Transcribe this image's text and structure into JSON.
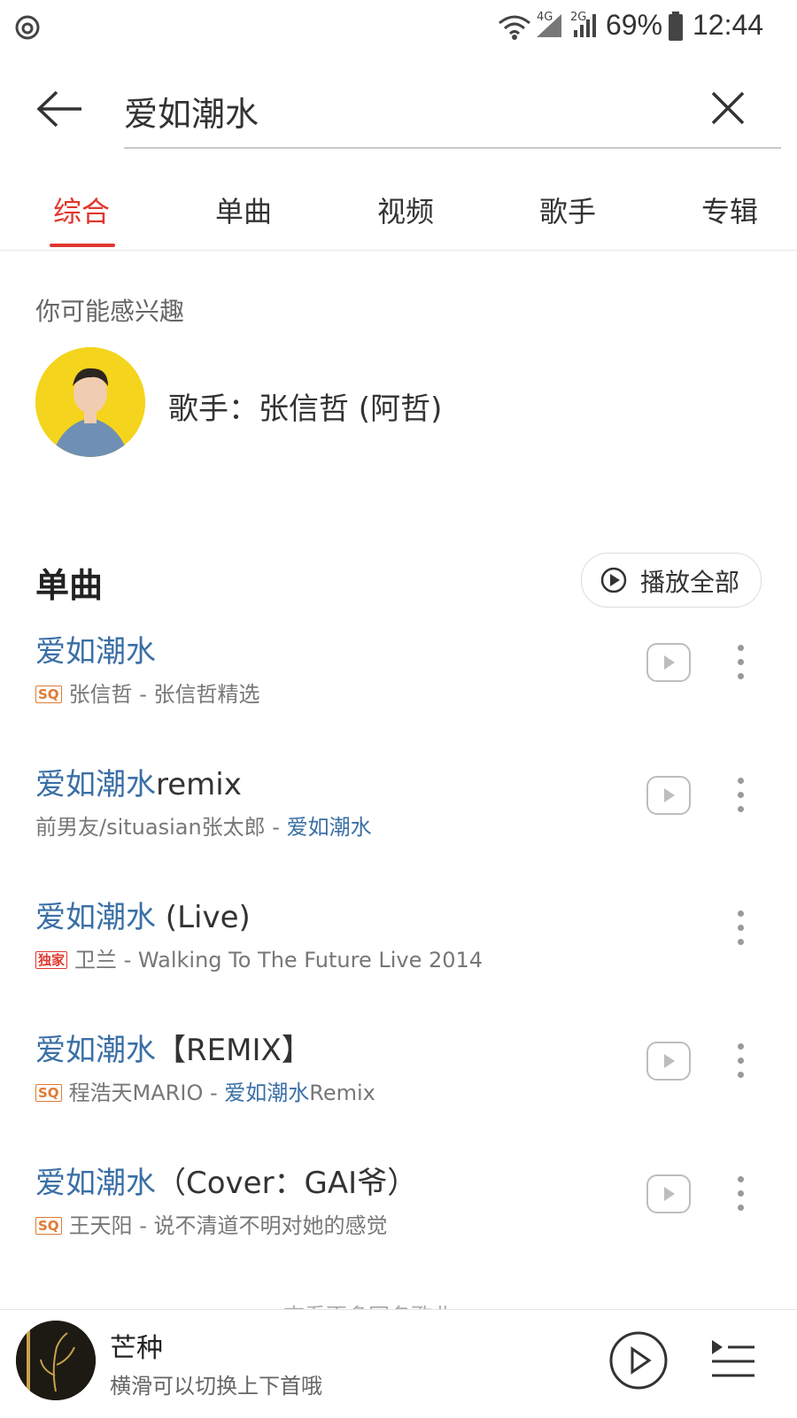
{
  "status_bar": {
    "battery": "69%",
    "time": "12:44",
    "network1": "4G",
    "network2": "2G",
    "icons": [
      "app-logo-icon",
      "wifi-icon",
      "signal-icon",
      "signal-icon",
      "battery-icon"
    ]
  },
  "search": {
    "query": "爱如潮水"
  },
  "tabs": [
    {
      "label": "综合",
      "active": true
    },
    {
      "label": "单曲",
      "active": false
    },
    {
      "label": "视频",
      "active": false
    },
    {
      "label": "歌手",
      "active": false
    },
    {
      "label": "专辑",
      "active": false
    }
  ],
  "suggestion": {
    "heading": "你可能感兴趣",
    "artist_label": "歌手：张信哲 (阿哲)"
  },
  "songs_section": {
    "title": "单曲",
    "play_all": "播放全部",
    "songs": [
      {
        "title_hl": "爱如潮水",
        "title_rest": "",
        "badge": "SQ",
        "artist": "张信哲 - 张信哲精选",
        "album_hl": "",
        "album_rest": "",
        "has_play": true
      },
      {
        "title_hl": "爱如潮水",
        "title_rest": "remix",
        "badge": "",
        "artist": "前男友/situasian张太郎 - ",
        "album_hl": "爱如潮水",
        "album_rest": "",
        "has_play": true
      },
      {
        "title_hl": "爱如潮水",
        "title_rest": " (Live)",
        "badge": "独家",
        "artist": "卫兰 - Walking To The Future Live 2014",
        "album_hl": "",
        "album_rest": "",
        "has_play": false
      },
      {
        "title_hl": "爱如潮水",
        "title_rest": "【REMIX】",
        "badge": "SQ",
        "artist": "程浩天MARIO - ",
        "album_hl": "爱如潮水",
        "album_rest": "Remix",
        "has_play": true
      },
      {
        "title_hl": "爱如潮水",
        "title_rest": "（Cover：GAI爷）",
        "badge": "SQ",
        "artist": "王天阳 - 说不清道不明对她的感觉",
        "album_hl": "",
        "album_rest": "",
        "has_play": true
      }
    ],
    "more_hint": "查看更多同名歌曲"
  },
  "player": {
    "title": "芒种",
    "hint": "横滑可以切换上下首哦"
  },
  "colors": {
    "accent": "#e0382f",
    "link": "#3a6fa6",
    "sq_badge": "#e07a32"
  }
}
